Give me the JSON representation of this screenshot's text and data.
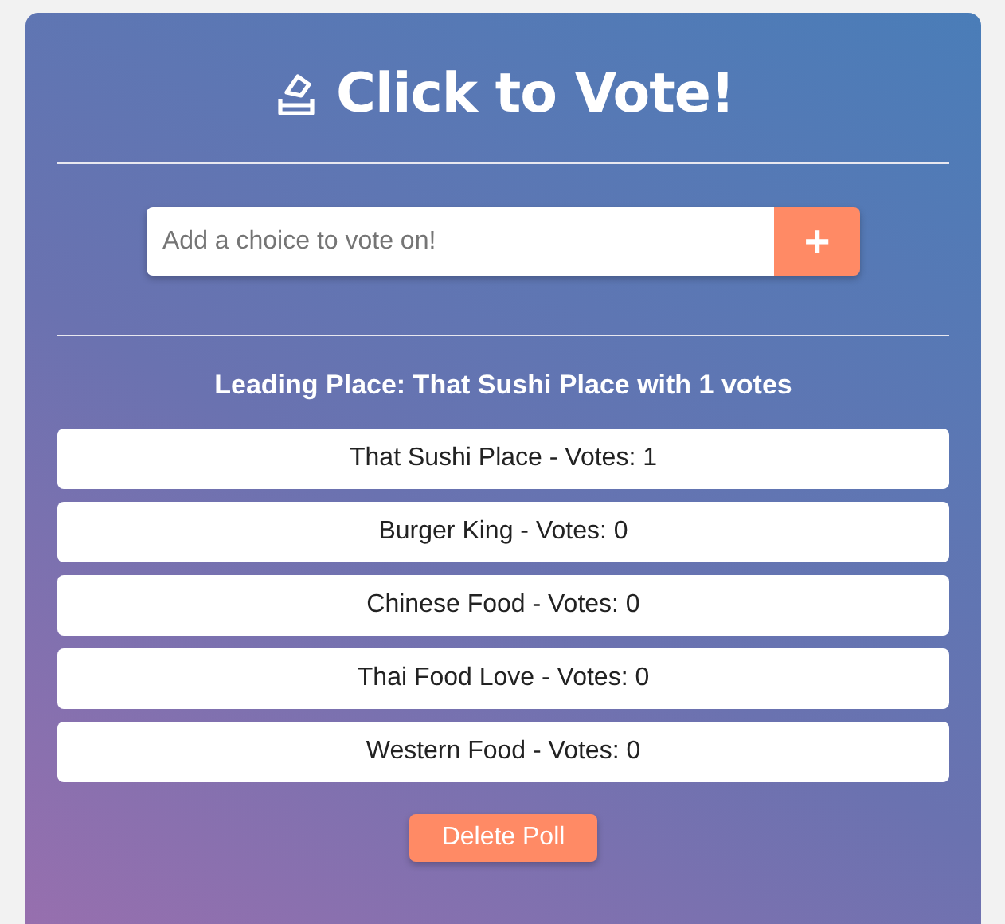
{
  "title": "Click to Vote!",
  "choice_input": {
    "placeholder": "Add a choice to vote on!"
  },
  "add_button": {
    "label": "+"
  },
  "leading": "Leading Place: That Sushi Place with 1 votes",
  "choices": [
    {
      "label": "That Sushi Place - Votes: 1"
    },
    {
      "label": "Burger King - Votes: 0"
    },
    {
      "label": "Chinese Food - Votes: 0"
    },
    {
      "label": "Thai Food Love - Votes: 0"
    },
    {
      "label": "Western Food - Votes: 0"
    }
  ],
  "delete_button": {
    "label": "Delete Poll"
  }
}
